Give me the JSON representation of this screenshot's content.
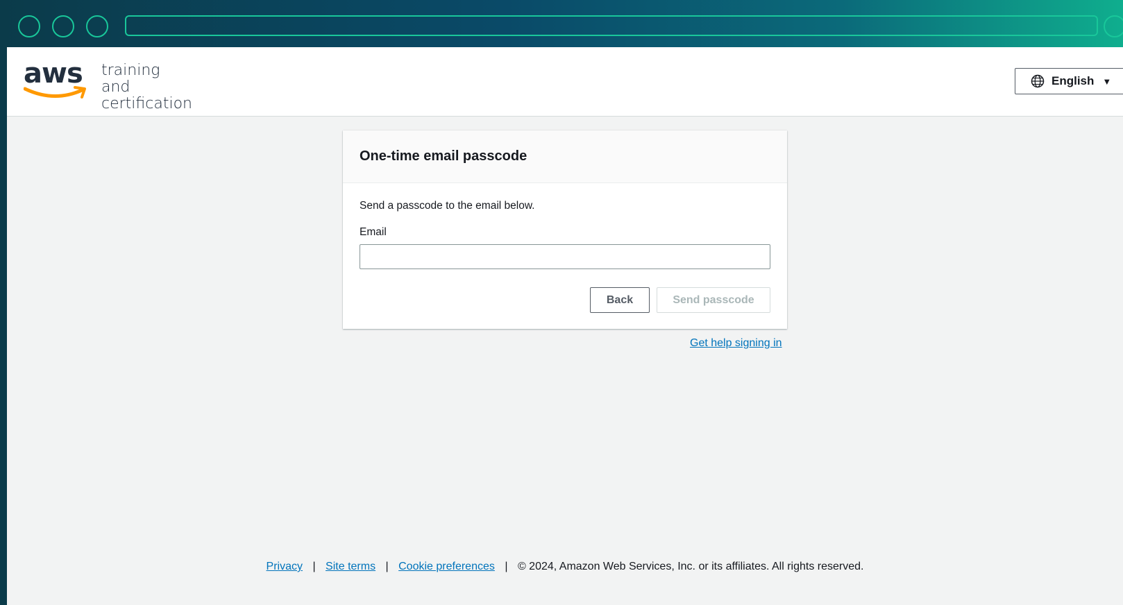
{
  "header": {
    "logo_wordmark": "aws",
    "logo_line1": "training and",
    "logo_line2": "certification",
    "language_label": "English"
  },
  "card": {
    "title": "One-time email passcode",
    "description": "Send a passcode to the email below.",
    "email_label": "Email",
    "email_value": "",
    "back_label": "Back",
    "send_label": "Send passcode"
  },
  "help_link": "Get help signing in",
  "footer": {
    "privacy": "Privacy",
    "site_terms": "Site terms",
    "cookie_preferences": "Cookie preferences",
    "separator": "|",
    "copyright": "© 2024, Amazon Web Services, Inc. or its affiliates. All rights reserved."
  },
  "colors": {
    "link": "#0073bb",
    "brand_orange": "#ff9900",
    "brand_dark": "#232f3e",
    "chrome_accent": "#19c79a"
  },
  "icons": {
    "globe": "globe-icon",
    "caret": "caret-down-icon"
  }
}
